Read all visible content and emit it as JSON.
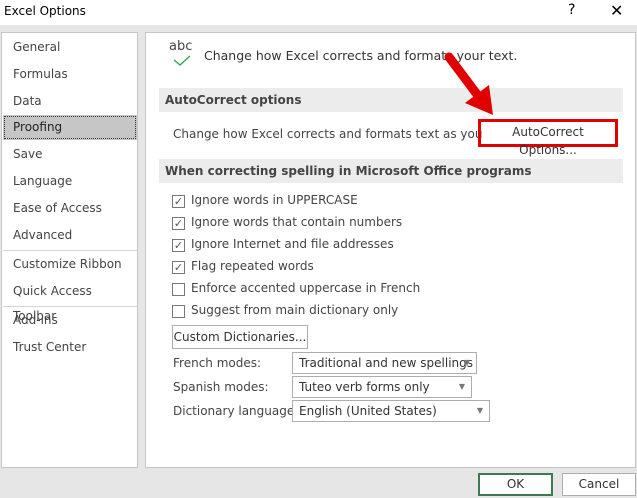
{
  "window": {
    "title": "Excel Options",
    "help": "?",
    "close": "✕"
  },
  "sidebar": {
    "items": [
      {
        "label": "General"
      },
      {
        "label": "Formulas"
      },
      {
        "label": "Data"
      },
      {
        "label": "Proofing",
        "selected": true
      },
      {
        "label": "Save"
      },
      {
        "label": "Language"
      },
      {
        "label": "Ease of Access"
      },
      {
        "label": "Advanced"
      },
      {
        "label": "Customize Ribbon"
      },
      {
        "label": "Quick Access Toolbar"
      },
      {
        "label": "Add-ins"
      },
      {
        "label": "Trust Center"
      }
    ]
  },
  "main": {
    "icon_text": "abc",
    "intro": "Change how Excel corrects and formats your text.",
    "autocorrect": {
      "header": "AutoCorrect options",
      "desc": "Change how Excel corrects and formats text as you type:",
      "button": "AutoCorrect Options..."
    },
    "spelling": {
      "header": "When correcting spelling in Microsoft Office programs",
      "options": [
        {
          "label": "Ignore words in UPPERCASE",
          "checked": true
        },
        {
          "label": "Ignore words that contain numbers",
          "checked": true
        },
        {
          "label": "Ignore Internet and file addresses",
          "checked": true
        },
        {
          "label": "Flag repeated words",
          "checked": true
        },
        {
          "label": "Enforce accented uppercase in French",
          "checked": false
        },
        {
          "label": "Suggest from main dictionary only",
          "checked": false
        }
      ],
      "custom_dict_button": "Custom Dictionaries...",
      "french_label": "French modes:",
      "french_value": "Traditional and new spellings",
      "spanish_label": "Spanish modes:",
      "spanish_value": "Tuteo verb forms only",
      "dict_label": "Dictionary language:",
      "dict_value": "English (United States)"
    }
  },
  "footer": {
    "ok": "OK",
    "cancel": "Cancel"
  },
  "colors": {
    "highlight": "#e00000",
    "ok_border": "#3c7a52",
    "check": "#2ea44f"
  }
}
